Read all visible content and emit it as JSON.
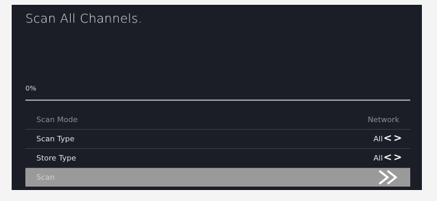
{
  "header": {
    "title": "Scan All Channels."
  },
  "progress": {
    "label": "0%",
    "fraction": 0
  },
  "menu": {
    "items": [
      {
        "label": "Scan Mode",
        "value": "Network",
        "state": "disabled"
      },
      {
        "label": "Scan Type",
        "value": "All",
        "icon": "left-right-arrows-icon"
      },
      {
        "label": "Store Type",
        "value": "All",
        "icon": "left-right-arrows-icon"
      },
      {
        "label": "Scan",
        "icon": "double-chevron-right-icon",
        "state": "selected"
      }
    ]
  },
  "colors": {
    "background": "#1b1e27",
    "selected_row": "#9a9a9a",
    "text": "#e0e0e0",
    "disabled_text": "#8a8d94"
  }
}
